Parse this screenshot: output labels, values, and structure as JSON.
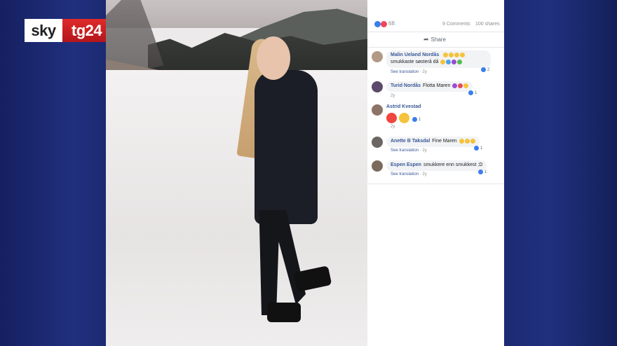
{
  "logo": {
    "sky": "sky",
    "tg24": "tg24",
    "brand_red": "#c81e24"
  },
  "post": {
    "reaction_count": "68",
    "comments": "9 Comments",
    "shares": "100 shares",
    "share_label": "Share",
    "share_icon": "share-arrow-icon"
  },
  "comments": [
    {
      "author": "Malin Ueland Nordås",
      "text": "smukkaste søsterå då",
      "see_translation": "See translation",
      "age": "2y",
      "reactions": "2"
    },
    {
      "author": "Turid Nordås",
      "text": "Flotta Maren",
      "age": "2y",
      "reactions": "1"
    },
    {
      "author": "Astrid Kvestad",
      "text": "",
      "age": "2y",
      "reactions": "1"
    },
    {
      "author": "Anette B Taksdal",
      "text": "Fine Maren",
      "see_translation": "See translation",
      "age": "2y",
      "reactions": "1"
    },
    {
      "author": "Espen Espen",
      "text": "smukkere enn smukkest ;D",
      "see_translation": "See translation",
      "age": "2y",
      "reactions": "1"
    }
  ]
}
